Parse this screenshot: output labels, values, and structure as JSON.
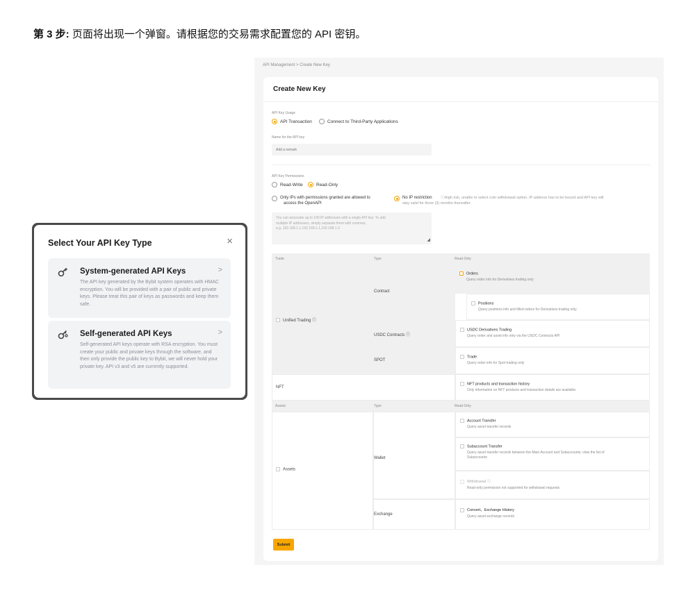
{
  "heading": {
    "step": "第 3 步:",
    "text": " 页面将出现一个弹窗。请根据您的交易需求配置您的 API 密钥。"
  },
  "modal": {
    "title": "Select Your API Key Type",
    "close": "×",
    "cards": [
      {
        "icon": "key-icon",
        "title": "System-generated API Keys",
        "desc": "The API key generated by the Bybit system operates with HMAC encryption. You will be provided with a pair of public and private keys. Please treat this pair of keys as passwords and keep them safe.",
        "chevron": ">"
      },
      {
        "icon": "key-icon",
        "title": "Self-generated API Keys",
        "desc": "Self-generated API keys operate with RSA encryption. You must create your public and private keys through the software, and then only provide the public key to Bybit, we will never hold your private key. API v3 and v5 are currently supported.",
        "chevron": ">"
      }
    ]
  },
  "form": {
    "breadcrumb": "API Management  >  Create New Key",
    "title": "Create New Key",
    "usage": {
      "label": "API Key Usage",
      "options": [
        "API Transaction",
        "Connect to Third-Party Applications"
      ],
      "selected": 0
    },
    "name": {
      "label": "Name for the API key",
      "placeholder": "Add a remark"
    },
    "permissions": {
      "label": "API Key Permissions",
      "options": [
        "Read-Write",
        "Read-Only"
      ],
      "selected": 1
    },
    "ip": {
      "option_ips_line1": "Only IPs with permissions granted are allowed to",
      "option_ips_line2": "access the OpenAPI",
      "option_none": "No IP restriction",
      "hint_line1": "ⓘHigh risk, unable to select coin withdrawal option. IP address has to be bound and API key will",
      "hint_line2": "stay valid for three (3) months thereafter.",
      "textarea_line1": "You can associate up to 100 IP addresses with a single API key. To add",
      "textarea_line2": "multiple IP addresses, simply separate them with commas,",
      "textarea_line3": "e.g. 192.168.1.1,192.168.1.1,192.168.1.3"
    },
    "table1": {
      "headers": [
        "Trade",
        "Type",
        "Read-Only"
      ],
      "group": "Unified Trading ⓘ",
      "types": [
        "Contract",
        "USDC Contracts ⓘ",
        "SPOT"
      ],
      "items": [
        {
          "title": "Orders",
          "desc": "Query order info for Derivatives trading only"
        },
        {
          "title": "Positions",
          "desc": "Query positions info and filled orders for Derivatives trading only"
        },
        {
          "title": "USDC Derivatives Trading",
          "desc": "Query order and asset info only via the USDC Contracts API"
        },
        {
          "title": "Trade",
          "desc": "Query order info for Spot trading only"
        },
        {
          "title": "NFT products and transaction history",
          "desc": "Only information on NFT products and transaction details are available."
        }
      ],
      "nft": "NFT"
    },
    "table2": {
      "headers": [
        "Assets",
        "Type",
        "Read-Only"
      ],
      "group": "Assets",
      "types": [
        "Wallet",
        "Exchange"
      ],
      "items": [
        {
          "title": "Account Transfer",
          "desc": "Query asset transfer records"
        },
        {
          "title": "Subaccount Transfer",
          "desc_line1": "Query asset transfer records between the Main Account and Subaccounts; view the list of",
          "desc_line2": "Subaccounts"
        },
        {
          "title": "Withdrawal ⓘ",
          "desc": "Read-only permission not supported for withdrawal requests"
        },
        {
          "title": "Convert、Exchange History",
          "desc": "Query asset exchange records"
        }
      ]
    },
    "submit": "Submit"
  }
}
